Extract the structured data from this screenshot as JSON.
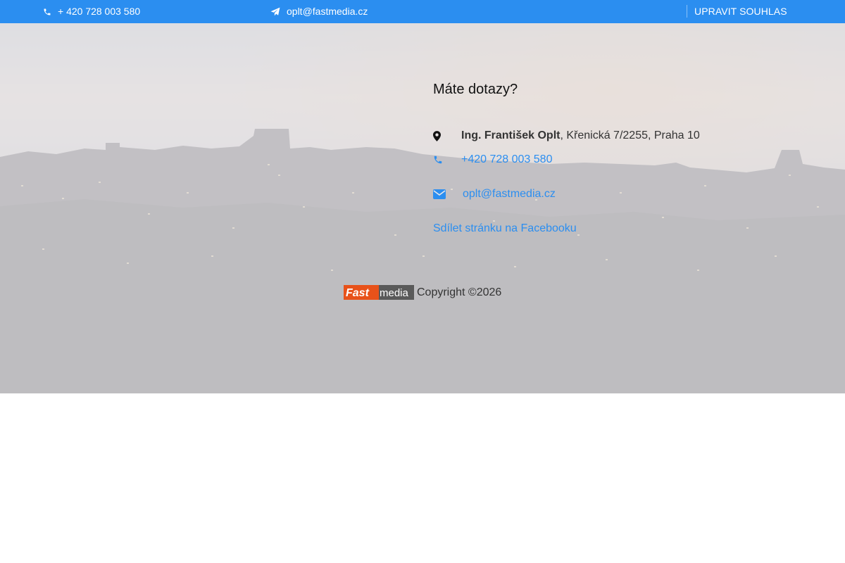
{
  "topbar": {
    "phone": "+ 420 728 003 580",
    "email": "oplt@fastmedia.cz",
    "consent_label": "UPRAVIT SOUHLAS",
    "phone_icon": "phone-icon",
    "email_icon": "paper-plane-icon",
    "background": "#2b8ef0"
  },
  "contact": {
    "heading": "Máte dotazy?",
    "name": "Ing. František Oplt",
    "address": ", Křenická 7/2255, Praha 10",
    "phone": "+420 728 003 580",
    "email": "oplt@fastmedia.cz",
    "facebook_share": "Sdílet stránku na Facebooku",
    "map_icon": "map-marker-icon",
    "phone_icon": "phone-icon",
    "email_icon": "envelope-icon",
    "link_color": "#2b8ef0"
  },
  "footer": {
    "logo_text_fast": "Fast",
    "logo_text_media": "media",
    "copyright": "Copyright ©2026",
    "logo_colors": {
      "fast": "#e8521a",
      "media": "#555555"
    }
  }
}
